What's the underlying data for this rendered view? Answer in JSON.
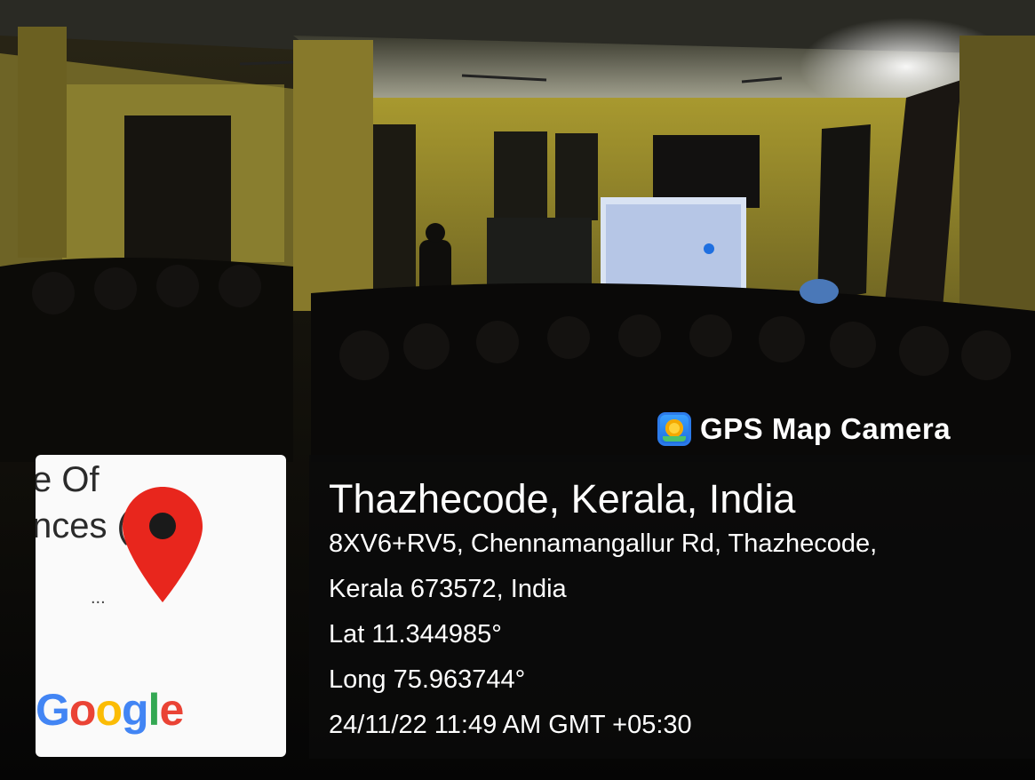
{
  "brand": {
    "name": "GPS Map Camera",
    "icon": "gps-map-camera-app-icon"
  },
  "map_thumbnail": {
    "label_line1": "e Of",
    "label_line2": "nces (",
    "ellipsis": "...",
    "google_logo": "Google",
    "pin_icon": "map-pin-icon",
    "colors": {
      "pin": "#e8261d",
      "G": "#4285f4",
      "o1": "#ea4335",
      "o2": "#fbbc05",
      "g": "#4285f4",
      "l": "#34a853",
      "e": "#ea4335"
    }
  },
  "location": {
    "title": "Thazhecode, Kerala, India",
    "address_line1": "8XV6+RV5, Chennamangallur Rd, Thazhecode,",
    "address_line2": "Kerala 673572, India",
    "latitude": "Lat 11.344985°",
    "longitude": "Long 75.963744°",
    "datetime": "24/11/22 11:49 AM GMT +05:30"
  }
}
